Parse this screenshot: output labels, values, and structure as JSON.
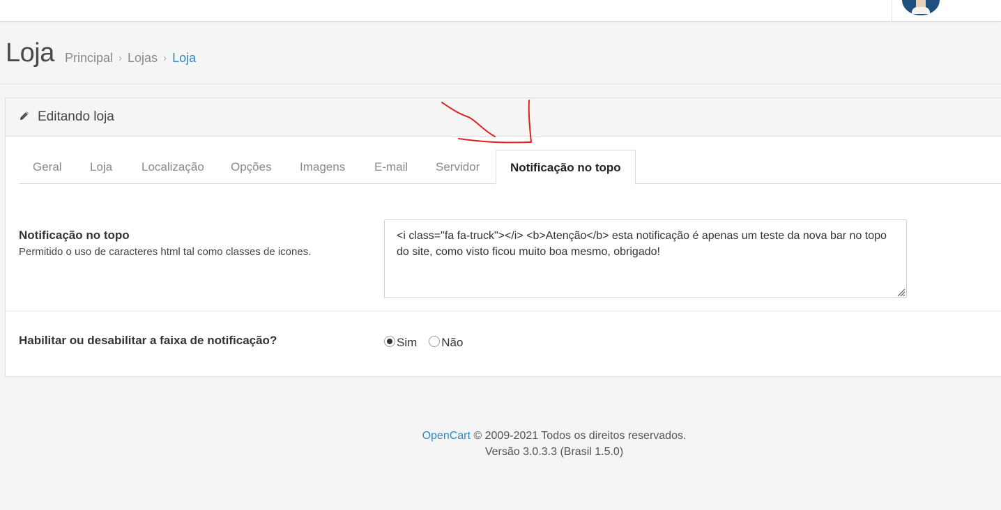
{
  "header": {
    "avatar_alt": ""
  },
  "page": {
    "title": "Loja",
    "breadcrumb": [
      {
        "label": "Principal"
      },
      {
        "label": "Lojas"
      },
      {
        "label": "Loja"
      }
    ],
    "breadcrumb_separator": "›"
  },
  "panel": {
    "title": "Editando loja",
    "icon": "pencil-icon"
  },
  "tabs": [
    {
      "label": "Geral",
      "active": false
    },
    {
      "label": "Loja",
      "active": false
    },
    {
      "label": "Localização",
      "active": false
    },
    {
      "label": "Opções",
      "active": false
    },
    {
      "label": "Imagens",
      "active": false
    },
    {
      "label": "E-mail",
      "active": false
    },
    {
      "label": "Servidor",
      "active": false
    },
    {
      "label": "Notificação no topo",
      "active": true
    }
  ],
  "form": {
    "notification": {
      "label": "Notificação no topo",
      "help": "Permitido o uso de caracteres html tal como classes de icones.",
      "value": "<i class=\"fa fa-truck\"></i> <b>Atenção</b> esta notificação é apenas um teste da nova bar no topo do site, como visto ficou muito boa mesmo, obrigado!"
    },
    "enable": {
      "label": "Habilitar ou desabilitar a faixa de notificação?",
      "options": [
        {
          "label": "Sim",
          "checked": true
        },
        {
          "label": "Não",
          "checked": false
        }
      ]
    }
  },
  "footer": {
    "brand": "OpenCart",
    "copyright": " © 2009-2021 Todos os direitos reservados.",
    "version": "Versão 3.0.3.3 (Brasil 1.5.0)"
  },
  "colors": {
    "link": "#2a8bc6",
    "annotation": "#e02020",
    "background": "#f5f5f5"
  }
}
